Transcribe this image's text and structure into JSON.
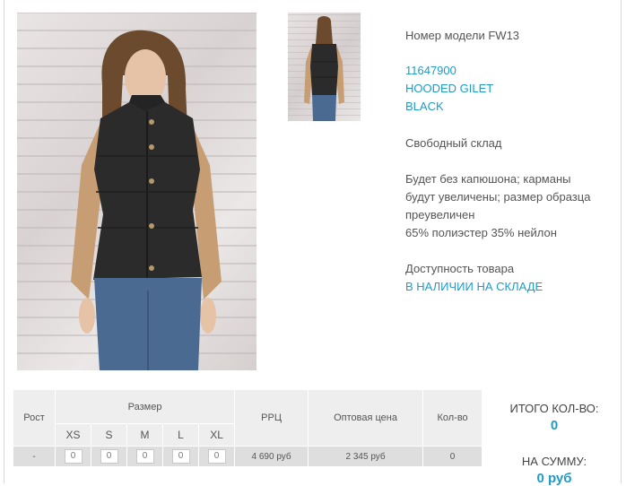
{
  "product": {
    "model_line": "Номер модели FW13",
    "article": "11647900",
    "name": "HOODED GILET",
    "color": "BLACK",
    "warehouse": "Свободный склад",
    "description_lines": [
      "Будет без капюшона; карманы",
      "будут увеличены; размер образца",
      "преувеличен",
      "65% полиэстер 35% нейлон"
    ],
    "availability_label": "Доступность товара",
    "availability_value": "В НАЛИЧИИ НА СКЛАДЕ"
  },
  "table": {
    "headers": {
      "height": "Рост",
      "size": "Размер",
      "rrp": "РРЦ",
      "wholesale": "Оптовая цена",
      "qty": "Кол-во"
    },
    "sizes": [
      "XS",
      "S",
      "M",
      "L",
      "XL"
    ],
    "row": {
      "height": "-",
      "quantities": [
        "0",
        "0",
        "0",
        "0",
        "0"
      ],
      "rrp": "4 690 руб",
      "wholesale": "2 345 руб",
      "qty": "0"
    }
  },
  "totals": {
    "count_label": "ИТОГО КОЛ-ВО:",
    "count_value": "0",
    "sum_label": "НА СУММУ:",
    "sum_value": "0 руб"
  },
  "colors": {
    "accent": "#1f9bc7",
    "text": "#555555",
    "table_bg": "#eeeeee"
  }
}
